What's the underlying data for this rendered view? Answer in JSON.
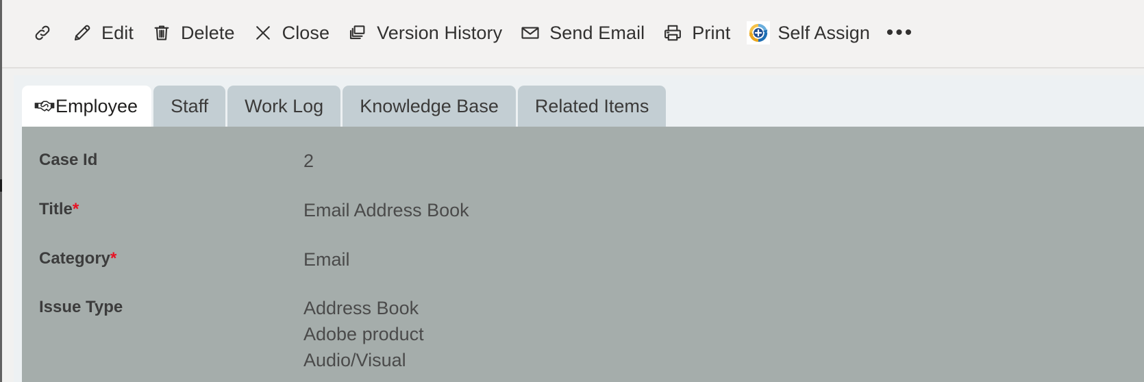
{
  "window": {
    "background": "#f1f1f0",
    "command_bar_background": "#f3f2f1",
    "form_background": "#a5adab",
    "accent": "#0078d4",
    "required_color": "#e81123"
  },
  "command_bar": {
    "buttons": [
      {
        "id": "link",
        "label": "",
        "icon": "link-icon",
        "icon_only": true
      },
      {
        "id": "edit",
        "label": "Edit",
        "icon": "pencil-icon",
        "icon_only": false
      },
      {
        "id": "delete",
        "label": "Delete",
        "icon": "trash-icon",
        "icon_only": false
      },
      {
        "id": "close",
        "label": "Close",
        "icon": "close-x-icon",
        "icon_only": false
      },
      {
        "id": "version-history",
        "label": "Version History",
        "icon": "version-history-icon",
        "icon_only": false
      },
      {
        "id": "send-email",
        "label": "Send Email",
        "icon": "envelope-icon",
        "icon_only": false
      },
      {
        "id": "print",
        "label": "Print",
        "icon": "printer-icon",
        "icon_only": false
      },
      {
        "id": "self-assign",
        "label": "Self Assign",
        "icon": "self-assign-icon",
        "icon_only": false
      }
    ],
    "overflow_label": "•••"
  },
  "tabs": {
    "items": [
      {
        "id": "employee",
        "label": "Employee",
        "icon": "handshake-icon",
        "active": true
      },
      {
        "id": "staff",
        "label": "Staff",
        "icon": "",
        "active": false
      },
      {
        "id": "work-log",
        "label": "Work Log",
        "icon": "",
        "active": false
      },
      {
        "id": "knowledge-base",
        "label": "Knowledge Base",
        "icon": "",
        "active": false
      },
      {
        "id": "related-items",
        "label": "Related Items",
        "icon": "",
        "active": false
      }
    ]
  },
  "form": {
    "fields": [
      {
        "id": "case-id",
        "label": "Case Id",
        "required": false,
        "values": [
          "2"
        ]
      },
      {
        "id": "title",
        "label": "Title",
        "required": true,
        "values": [
          "Email Address Book"
        ]
      },
      {
        "id": "category",
        "label": "Category",
        "required": true,
        "values": [
          "Email"
        ]
      },
      {
        "id": "issue-type",
        "label": "Issue Type",
        "required": false,
        "values": [
          "Address Book",
          "Adobe product",
          "Audio/Visual"
        ]
      }
    ]
  }
}
